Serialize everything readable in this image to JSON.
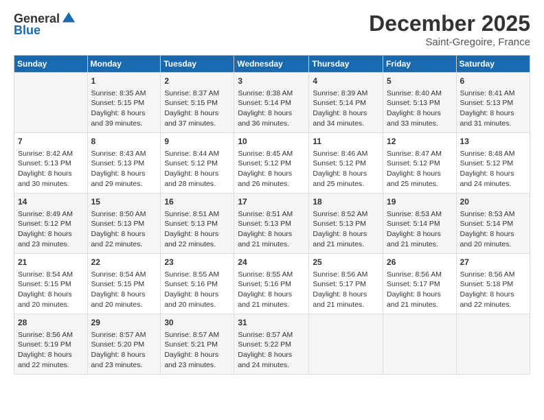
{
  "header": {
    "logo_general": "General",
    "logo_blue": "Blue",
    "month": "December 2025",
    "location": "Saint-Gregoire, France"
  },
  "days_of_week": [
    "Sunday",
    "Monday",
    "Tuesday",
    "Wednesday",
    "Thursday",
    "Friday",
    "Saturday"
  ],
  "weeks": [
    [
      {
        "day": "",
        "info": ""
      },
      {
        "day": "1",
        "info": "Sunrise: 8:35 AM\nSunset: 5:15 PM\nDaylight: 8 hours\nand 39 minutes."
      },
      {
        "day": "2",
        "info": "Sunrise: 8:37 AM\nSunset: 5:15 PM\nDaylight: 8 hours\nand 37 minutes."
      },
      {
        "day": "3",
        "info": "Sunrise: 8:38 AM\nSunset: 5:14 PM\nDaylight: 8 hours\nand 36 minutes."
      },
      {
        "day": "4",
        "info": "Sunrise: 8:39 AM\nSunset: 5:14 PM\nDaylight: 8 hours\nand 34 minutes."
      },
      {
        "day": "5",
        "info": "Sunrise: 8:40 AM\nSunset: 5:13 PM\nDaylight: 8 hours\nand 33 minutes."
      },
      {
        "day": "6",
        "info": "Sunrise: 8:41 AM\nSunset: 5:13 PM\nDaylight: 8 hours\nand 31 minutes."
      }
    ],
    [
      {
        "day": "7",
        "info": "Sunrise: 8:42 AM\nSunset: 5:13 PM\nDaylight: 8 hours\nand 30 minutes."
      },
      {
        "day": "8",
        "info": "Sunrise: 8:43 AM\nSunset: 5:13 PM\nDaylight: 8 hours\nand 29 minutes."
      },
      {
        "day": "9",
        "info": "Sunrise: 8:44 AM\nSunset: 5:12 PM\nDaylight: 8 hours\nand 28 minutes."
      },
      {
        "day": "10",
        "info": "Sunrise: 8:45 AM\nSunset: 5:12 PM\nDaylight: 8 hours\nand 26 minutes."
      },
      {
        "day": "11",
        "info": "Sunrise: 8:46 AM\nSunset: 5:12 PM\nDaylight: 8 hours\nand 25 minutes."
      },
      {
        "day": "12",
        "info": "Sunrise: 8:47 AM\nSunset: 5:12 PM\nDaylight: 8 hours\nand 25 minutes."
      },
      {
        "day": "13",
        "info": "Sunrise: 8:48 AM\nSunset: 5:12 PM\nDaylight: 8 hours\nand 24 minutes."
      }
    ],
    [
      {
        "day": "14",
        "info": "Sunrise: 8:49 AM\nSunset: 5:12 PM\nDaylight: 8 hours\nand 23 minutes."
      },
      {
        "day": "15",
        "info": "Sunrise: 8:50 AM\nSunset: 5:13 PM\nDaylight: 8 hours\nand 22 minutes."
      },
      {
        "day": "16",
        "info": "Sunrise: 8:51 AM\nSunset: 5:13 PM\nDaylight: 8 hours\nand 22 minutes."
      },
      {
        "day": "17",
        "info": "Sunrise: 8:51 AM\nSunset: 5:13 PM\nDaylight: 8 hours\nand 21 minutes."
      },
      {
        "day": "18",
        "info": "Sunrise: 8:52 AM\nSunset: 5:13 PM\nDaylight: 8 hours\nand 21 minutes."
      },
      {
        "day": "19",
        "info": "Sunrise: 8:53 AM\nSunset: 5:14 PM\nDaylight: 8 hours\nand 21 minutes."
      },
      {
        "day": "20",
        "info": "Sunrise: 8:53 AM\nSunset: 5:14 PM\nDaylight: 8 hours\nand 20 minutes."
      }
    ],
    [
      {
        "day": "21",
        "info": "Sunrise: 8:54 AM\nSunset: 5:15 PM\nDaylight: 8 hours\nand 20 minutes."
      },
      {
        "day": "22",
        "info": "Sunrise: 8:54 AM\nSunset: 5:15 PM\nDaylight: 8 hours\nand 20 minutes."
      },
      {
        "day": "23",
        "info": "Sunrise: 8:55 AM\nSunset: 5:16 PM\nDaylight: 8 hours\nand 20 minutes."
      },
      {
        "day": "24",
        "info": "Sunrise: 8:55 AM\nSunset: 5:16 PM\nDaylight: 8 hours\nand 21 minutes."
      },
      {
        "day": "25",
        "info": "Sunrise: 8:56 AM\nSunset: 5:17 PM\nDaylight: 8 hours\nand 21 minutes."
      },
      {
        "day": "26",
        "info": "Sunrise: 8:56 AM\nSunset: 5:17 PM\nDaylight: 8 hours\nand 21 minutes."
      },
      {
        "day": "27",
        "info": "Sunrise: 8:56 AM\nSunset: 5:18 PM\nDaylight: 8 hours\nand 22 minutes."
      }
    ],
    [
      {
        "day": "28",
        "info": "Sunrise: 8:56 AM\nSunset: 5:19 PM\nDaylight: 8 hours\nand 22 minutes."
      },
      {
        "day": "29",
        "info": "Sunrise: 8:57 AM\nSunset: 5:20 PM\nDaylight: 8 hours\nand 23 minutes."
      },
      {
        "day": "30",
        "info": "Sunrise: 8:57 AM\nSunset: 5:21 PM\nDaylight: 8 hours\nand 23 minutes."
      },
      {
        "day": "31",
        "info": "Sunrise: 8:57 AM\nSunset: 5:22 PM\nDaylight: 8 hours\nand 24 minutes."
      },
      {
        "day": "",
        "info": ""
      },
      {
        "day": "",
        "info": ""
      },
      {
        "day": "",
        "info": ""
      }
    ]
  ]
}
